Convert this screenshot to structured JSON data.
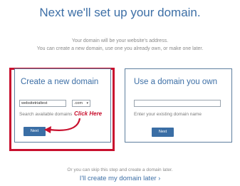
{
  "header": {
    "title": "Next we'll set up your domain.",
    "subtitle_line1": "Your domain will be your website's address.",
    "subtitle_line2": "You can create a new domain, use one you already own, or make one later."
  },
  "new_domain": {
    "title": "Create a new domain",
    "domain_value": "websitetrialtest",
    "tld_value": ".com",
    "help_text": "Search available domains",
    "next_label": "Next"
  },
  "annotation": {
    "text": "Click Here",
    "color": "#c8102e"
  },
  "own_domain": {
    "title": "Use a domain you own",
    "input_value": "",
    "help_text": "Enter your existing domain name",
    "next_label": "Next"
  },
  "footer": {
    "skip_text": "Or you can skip this step and create a domain later.",
    "later_link": "I'll create my domain later"
  },
  "colors": {
    "accent": "#3d6fa6",
    "button": "#3a6ea5",
    "highlight": "#c8102e"
  },
  "icons": {
    "chevron": "chevron-right-icon",
    "dropdown": "chevron-down-icon",
    "arrow": "curved-arrow-icon"
  }
}
